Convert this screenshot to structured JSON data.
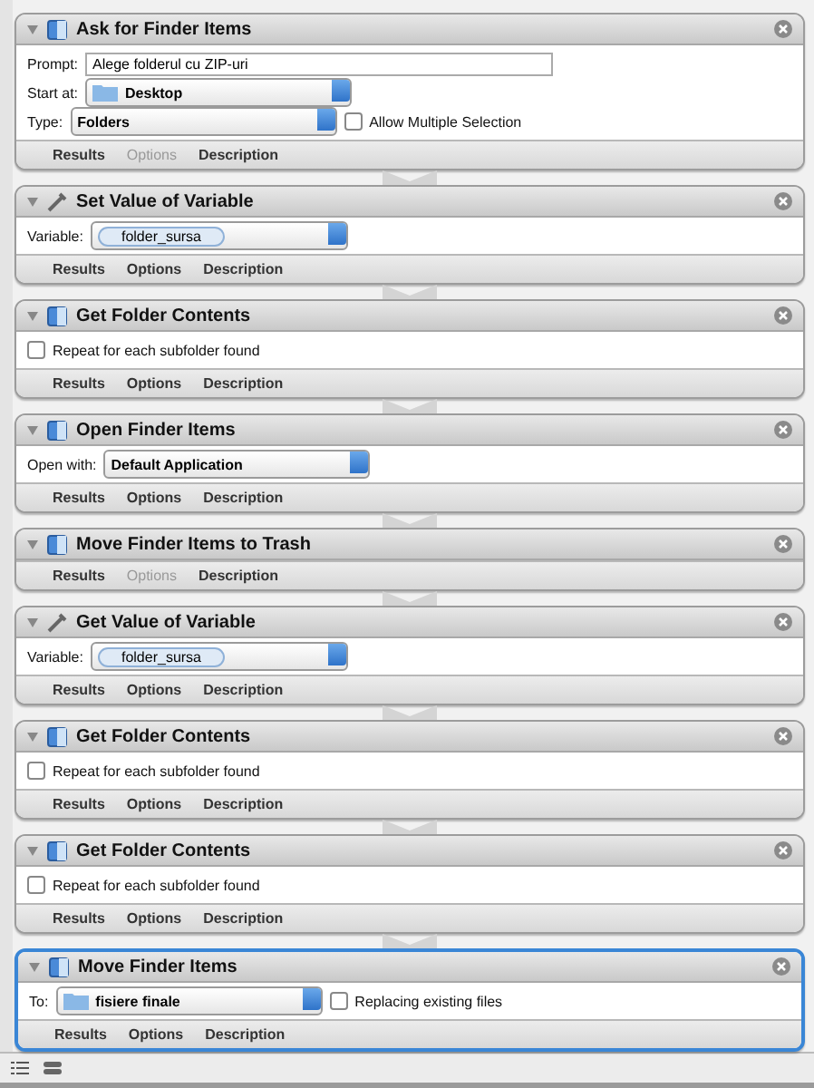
{
  "actions": [
    {
      "title": "Ask for Finder Items",
      "kind": "finder",
      "selected": false,
      "rows": [
        {
          "label": "Prompt:",
          "field": {
            "kind": "text",
            "value": "Alege folderul cu ZIP-uri"
          }
        },
        {
          "label": "Start at:",
          "field": {
            "kind": "popup",
            "value": "Desktop",
            "folder": true
          }
        },
        {
          "label": "Type:",
          "field": {
            "kind": "popup",
            "value": "Folders",
            "folder": false
          },
          "checkbox": {
            "label": "Allow Multiple Selection",
            "checked": false
          }
        }
      ],
      "tabs": [
        {
          "label": "Results",
          "disabled": false
        },
        {
          "label": "Options",
          "disabled": true
        },
        {
          "label": "Description",
          "disabled": false
        }
      ]
    },
    {
      "title": "Set Value of Variable",
      "kind": "variable",
      "selected": false,
      "rows": [
        {
          "label": "Variable:",
          "field": {
            "kind": "variable",
            "value": "folder_sursa"
          }
        }
      ],
      "tabs": [
        {
          "label": "Results",
          "disabled": false
        },
        {
          "label": "Options",
          "disabled": false
        },
        {
          "label": "Description",
          "disabled": false
        }
      ]
    },
    {
      "title": "Get Folder Contents",
      "kind": "finder",
      "selected": false,
      "rows": [
        {
          "checkbox": {
            "label": "Repeat for each subfolder found",
            "checked": false
          }
        }
      ],
      "tabs": [
        {
          "label": "Results",
          "disabled": false
        },
        {
          "label": "Options",
          "disabled": false
        },
        {
          "label": "Description",
          "disabled": false
        }
      ]
    },
    {
      "title": "Open Finder Items",
      "kind": "finder",
      "selected": false,
      "rows": [
        {
          "label": "Open with:",
          "field": {
            "kind": "popup",
            "value": "Default Application",
            "folder": false
          }
        }
      ],
      "tabs": [
        {
          "label": "Results",
          "disabled": false
        },
        {
          "label": "Options",
          "disabled": false
        },
        {
          "label": "Description",
          "disabled": false
        }
      ]
    },
    {
      "title": "Move Finder Items to Trash",
      "kind": "finder",
      "selected": false,
      "tabs": [
        {
          "label": "Results",
          "disabled": false
        },
        {
          "label": "Options",
          "disabled": true
        },
        {
          "label": "Description",
          "disabled": false
        }
      ]
    },
    {
      "title": "Get Value of Variable",
      "kind": "variable",
      "selected": false,
      "rows": [
        {
          "label": "Variable:",
          "field": {
            "kind": "variable",
            "value": "folder_sursa"
          }
        }
      ],
      "tabs": [
        {
          "label": "Results",
          "disabled": false
        },
        {
          "label": "Options",
          "disabled": false
        },
        {
          "label": "Description",
          "disabled": false
        }
      ]
    },
    {
      "title": "Get Folder Contents",
      "kind": "finder",
      "selected": false,
      "rows": [
        {
          "checkbox": {
            "label": "Repeat for each subfolder found",
            "checked": false
          }
        }
      ],
      "tabs": [
        {
          "label": "Results",
          "disabled": false
        },
        {
          "label": "Options",
          "disabled": false
        },
        {
          "label": "Description",
          "disabled": false
        }
      ]
    },
    {
      "title": "Get Folder Contents",
      "kind": "finder",
      "selected": false,
      "rows": [
        {
          "checkbox": {
            "label": "Repeat for each subfolder found",
            "checked": false
          }
        }
      ],
      "tabs": [
        {
          "label": "Results",
          "disabled": false
        },
        {
          "label": "Options",
          "disabled": false
        },
        {
          "label": "Description",
          "disabled": false
        }
      ]
    },
    {
      "title": "Move Finder Items",
      "kind": "finder",
      "selected": true,
      "rows": [
        {
          "label": "To:",
          "field": {
            "kind": "popup",
            "value": "fisiere finale",
            "folder": true
          },
          "checkbox": {
            "label": "Replacing existing files",
            "checked": false
          }
        }
      ],
      "tabs": [
        {
          "label": "Results",
          "disabled": false
        },
        {
          "label": "Options",
          "disabled": false
        },
        {
          "label": "Description",
          "disabled": false
        }
      ]
    }
  ]
}
